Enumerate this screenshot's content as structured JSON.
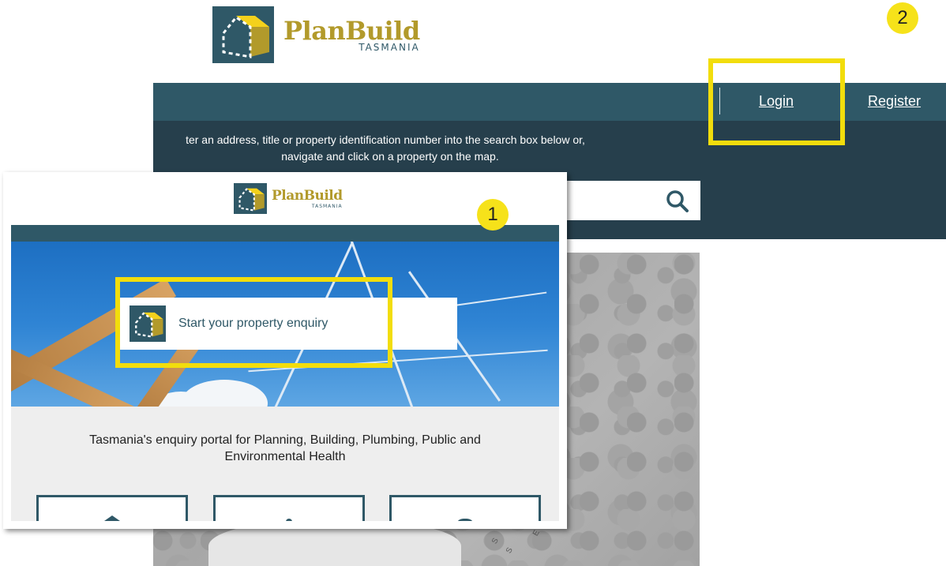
{
  "brand": {
    "name": "PlanBuild",
    "region": "TASMANIA"
  },
  "nav": {
    "login_label": "Login",
    "register_label": "Register"
  },
  "search": {
    "instructions_line1": "ter an address, title or property identification number into the search box below or,",
    "instructions_line2": "navigate and click on a property on the map.",
    "placeholder": ""
  },
  "map": {
    "letters": [
      "S",
      "E",
      "S"
    ]
  },
  "inset": {
    "enquiry_button_label": "Start your property enquiry",
    "tagline_line1": "Tasmania's enquiry portal for Planning, Building, Plumbing, Public and",
    "tagline_line2": "Environmental Health"
  },
  "annotations": {
    "step1": "1",
    "step2": "2"
  },
  "colors": {
    "brand_teal": "#2f5867",
    "brand_gold": "#b29a2b",
    "dark_panel": "#263f4c",
    "highlight": "#f2dd0c",
    "badge": "#f6e21a"
  }
}
